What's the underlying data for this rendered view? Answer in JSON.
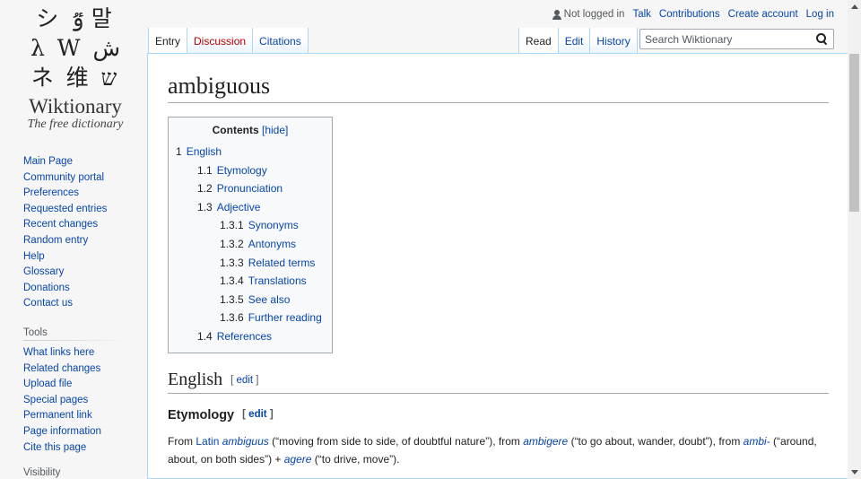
{
  "logo": {
    "glyphs_row1": "シ ٷ 말",
    "glyphs_row2": "λ W ش",
    "glyphs_row3": "ネ 维 ש",
    "name": "Wiktionary",
    "tagline": "The free dictionary"
  },
  "personal": {
    "not_logged_in": "Not logged in",
    "talk": "Talk",
    "contributions": "Contributions",
    "create_account": "Create account",
    "log_in": "Log in"
  },
  "tabs": {
    "entry": "Entry",
    "discussion": "Discussion",
    "citations": "Citations",
    "read": "Read",
    "edit": "Edit",
    "history": "History"
  },
  "search": {
    "placeholder": "Search Wiktionary"
  },
  "sidebar": {
    "nav": [
      "Main Page",
      "Community portal",
      "Preferences",
      "Requested entries",
      "Recent changes",
      "Random entry",
      "Help",
      "Glossary",
      "Donations",
      "Contact us"
    ],
    "tools_heading": "Tools",
    "tools": [
      "What links here",
      "Related changes",
      "Upload file",
      "Special pages",
      "Permanent link",
      "Page information",
      "Cite this page"
    ],
    "visibility_heading": "Visibility"
  },
  "page": {
    "title": "ambiguous"
  },
  "toc": {
    "title": "Contents",
    "toggle": "[hide]",
    "items": [
      {
        "num": "1",
        "label": "English",
        "level": 1
      },
      {
        "num": "1.1",
        "label": "Etymology",
        "level": 2
      },
      {
        "num": "1.2",
        "label": "Pronunciation",
        "level": 2
      },
      {
        "num": "1.3",
        "label": "Adjective",
        "level": 2
      },
      {
        "num": "1.3.1",
        "label": "Synonyms",
        "level": 3
      },
      {
        "num": "1.3.2",
        "label": "Antonyms",
        "level": 3
      },
      {
        "num": "1.3.3",
        "label": "Related terms",
        "level": 3
      },
      {
        "num": "1.3.4",
        "label": "Translations",
        "level": 3
      },
      {
        "num": "1.3.5",
        "label": "See also",
        "level": 3
      },
      {
        "num": "1.3.6",
        "label": "Further reading",
        "level": 3
      },
      {
        "num": "1.4",
        "label": "References",
        "level": 2
      }
    ]
  },
  "sections": {
    "english": "English",
    "etymology": "Etymology",
    "edit_open": "[",
    "edit_label": "edit",
    "edit_close": "]"
  },
  "etymology_text": {
    "t1": "From ",
    "latin": "Latin",
    "t2": " ",
    "ambiguus": "ambiguus",
    "t3": " (“moving from side to side, of doubtful nature”), from ",
    "ambigere": "ambigere",
    "t4": " (“to go about, wander, doubt”), from ",
    "ambi": "ambi-",
    "t5": " (“around, about, on both sides”) + ",
    "agere": "agere",
    "t6": " (“to drive, move”)."
  }
}
